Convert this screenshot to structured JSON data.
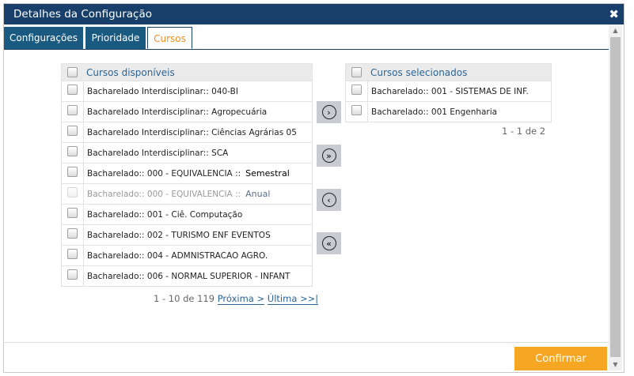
{
  "dialog": {
    "title": "Detalhes da Configuração",
    "close": "✖"
  },
  "tabs": [
    {
      "label": "Configurações"
    },
    {
      "label": "Prioridade"
    },
    {
      "label": "Cursos"
    }
  ],
  "available": {
    "header": "Cursos disponíveis",
    "rows": [
      {
        "label": "Bacharelado Interdisciplinar:: 040-BI"
      },
      {
        "label": "Bacharelado Interdisciplinar:: Agropecuária"
      },
      {
        "label": "Bacharelado Interdisciplinar:: Ciências Agrárias 05"
      },
      {
        "label": "Bacharelado Interdisciplinar:: SCA"
      },
      {
        "label": "Bacharelado:: 000 - EQUIVALENCIA ::",
        "tag": "Semestral"
      },
      {
        "label": "Bacharelado:: 000 - EQUIVALENCIA ::",
        "tag": "Anual"
      },
      {
        "label": "Bacharelado:: 001 - Ciê. Computação"
      },
      {
        "label": "Bacharelado:: 002 - TURISMO ENF EVENTOS"
      },
      {
        "label": "Bacharelado:: 004 - ADMNISTRACAO AGRO."
      },
      {
        "label": "Bacharelado:: 006 - NORMAL SUPERIOR - INFANT"
      }
    ],
    "pager": {
      "range": "1 - 10 de 119",
      "next": "Próxima >",
      "last": "Última >>|"
    }
  },
  "selected": {
    "header": "Cursos selecionados",
    "rows": [
      {
        "label": "Bacharelado:: 001 - SISTEMAS DE INF."
      },
      {
        "label": "Bacharelado:: 001 Engenharia"
      }
    ],
    "pager": {
      "range": "1 - 1 de 2"
    }
  },
  "move_buttons": {
    "add": "›",
    "add_all": "»",
    "remove": "‹",
    "remove_all": "«"
  },
  "footer": {
    "confirm": "Confirmar"
  },
  "colors": {
    "header": "#173f6a",
    "tab": "#1b5a80",
    "accent": "#f28c1e",
    "confirm": "#f5a623"
  }
}
